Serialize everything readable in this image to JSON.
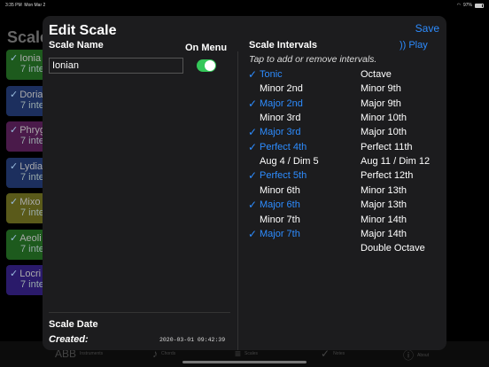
{
  "status_bar": {
    "time": "3:35 PM",
    "date": "Mon Mar 2",
    "battery": "97%"
  },
  "background": {
    "title": "Scale",
    "items": [
      {
        "name": "Ionia",
        "sub": "7 inte",
        "color": "#1d5a1d"
      },
      {
        "name": "Doria",
        "sub": "7 inte",
        "color": "#1c2f5e"
      },
      {
        "name": "Phryg",
        "sub": "7 inte",
        "color": "#4a1a4a"
      },
      {
        "name": "Lydia",
        "sub": "7 inte",
        "color": "#1c2f5e"
      },
      {
        "name": "Mixo",
        "sub": "7 inte",
        "color": "#5a5a1a"
      },
      {
        "name": "Aeoli",
        "sub": "7 inte",
        "color": "#1d5a1d"
      },
      {
        "name": "Locri",
        "sub": "7 inte",
        "color": "#2a1a6a"
      }
    ],
    "tabs": [
      {
        "icon": "ABB",
        "label": "Instruments"
      },
      {
        "icon": "♪",
        "label": "Chords"
      },
      {
        "icon": "≡",
        "label": "Scales"
      },
      {
        "icon": "✓",
        "label": "Notes"
      },
      {
        "icon": "ⓘ",
        "label": "About"
      }
    ]
  },
  "modal": {
    "title": "Edit Scale",
    "save_label": "Save",
    "scale_name_label": "Scale Name",
    "scale_name_value": "Ionian",
    "on_menu_label": "On Menu",
    "on_menu": true,
    "scale_date_label": "Scale Date",
    "created_label": "Created:",
    "created_value": "2020-03-01 09:42:39",
    "intervals_label": "Scale Intervals",
    "play_label": "Play",
    "hint": "Tap to add or remove intervals.",
    "intervals_left": [
      {
        "label": "Tonic",
        "selected": true
      },
      {
        "label": "Minor 2nd",
        "selected": false
      },
      {
        "label": "Major 2nd",
        "selected": true
      },
      {
        "label": "Minor 3rd",
        "selected": false
      },
      {
        "label": "Major 3rd",
        "selected": true
      },
      {
        "label": "Perfect 4th",
        "selected": true
      },
      {
        "label": "Aug 4 / Dim 5",
        "selected": false
      },
      {
        "label": "Perfect 5th",
        "selected": true
      },
      {
        "label": "Minor 6th",
        "selected": false
      },
      {
        "label": "Major 6th",
        "selected": true
      },
      {
        "label": "Minor 7th",
        "selected": false
      },
      {
        "label": "Major 7th",
        "selected": true
      }
    ],
    "intervals_right": [
      {
        "label": "Octave",
        "selected": false
      },
      {
        "label": "Minor 9th",
        "selected": false
      },
      {
        "label": "Major 9th",
        "selected": false
      },
      {
        "label": "Minor 10th",
        "selected": false
      },
      {
        "label": "Major 10th",
        "selected": false
      },
      {
        "label": "Perfect 11th",
        "selected": false
      },
      {
        "label": "Aug 11 / Dim 12",
        "selected": false
      },
      {
        "label": "Perfect 12th",
        "selected": false
      },
      {
        "label": "Minor 13th",
        "selected": false
      },
      {
        "label": "Major 13th",
        "selected": false
      },
      {
        "label": "Minor 14th",
        "selected": false
      },
      {
        "label": "Major 14th",
        "selected": false
      },
      {
        "label": "Double Octave",
        "selected": false
      }
    ],
    "accent_color": "#2d8cff",
    "check_icon": "checkmark-icon"
  }
}
